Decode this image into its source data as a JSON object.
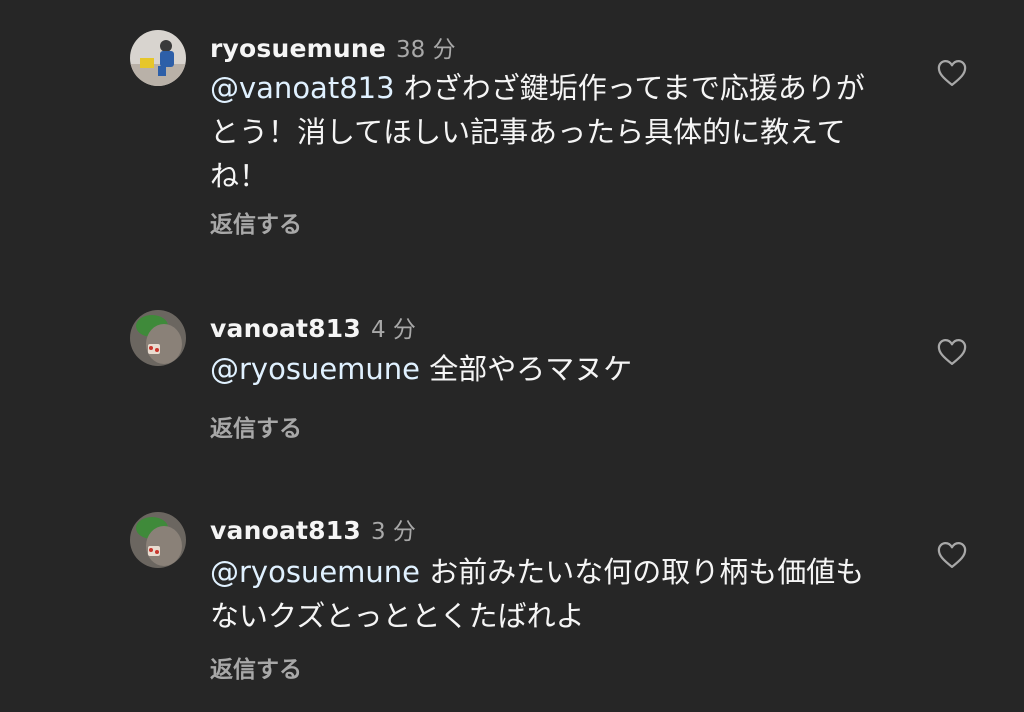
{
  "comments": [
    {
      "username": "ryosuemune",
      "time": "38 分",
      "mention": "@vanoat813",
      "text": " わざわざ鍵垢作ってまで応援ありがとう！消してほしい記事あったら具体的に教えてね！",
      "reply_label": "返信する",
      "avatar_icon": "user-avatar-photo",
      "like_icon": "heart-outline-icon"
    },
    {
      "username": "vanoat813",
      "time": "4 分",
      "mention": "@ryosuemune",
      "text": " 全部やろマヌケ",
      "reply_label": "返信する",
      "avatar_icon": "user-avatar-photo",
      "like_icon": "heart-outline-icon"
    },
    {
      "username": "vanoat813",
      "time": "3 分",
      "mention": "@ryosuemune",
      "text": " お前みたいな何の取り柄も価値もないクズとっととくたばれよ",
      "reply_label": "返信する",
      "avatar_icon": "user-avatar-photo",
      "like_icon": "heart-outline-icon"
    }
  ],
  "colors": {
    "background": "#262626",
    "primary_text": "#f5f5f5",
    "secondary_text": "#a8a8a8"
  }
}
